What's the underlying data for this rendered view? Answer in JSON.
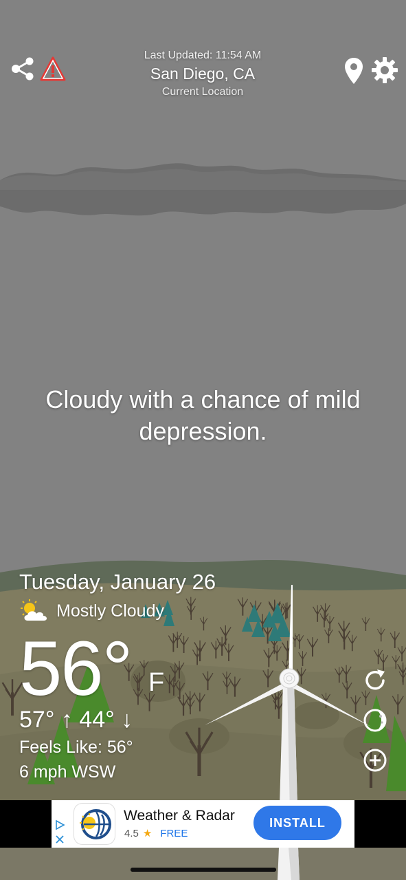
{
  "header": {
    "last_updated": "Last Updated: 11:54 AM",
    "city": "San Diego, CA",
    "location_type": "Current Location",
    "icons": [
      "share-icon",
      "alert-icon",
      "location-pin-icon",
      "gear-icon"
    ]
  },
  "quote": {
    "text": "Cloudy with a chance of mild depression."
  },
  "weather": {
    "date": "Tuesday, January 26",
    "condition_icon": "partly-cloudy-icon",
    "condition": "Mostly Cloudy",
    "temperature": "56°",
    "unit": "F",
    "hi_lo": "57° ↑  44° ↓",
    "feels_like": "Feels Like: 56°",
    "wind": "6 mph WSW"
  },
  "side_actions": {
    "icons": [
      "refresh-icon",
      "moon-phase-icon",
      "add-icon"
    ]
  },
  "ad": {
    "app_name": "Weather & Radar",
    "rating": "4.5",
    "price": "FREE",
    "cta": "INSTALL",
    "icons": [
      "ad-choices-icon",
      "app-logo-icon",
      "star-icon"
    ]
  },
  "colors": {
    "sky": "#828282",
    "ground": "#807c60",
    "tree": "#4a3f34",
    "pine": "#2e7a78",
    "grass_tree": "#4a8a2c",
    "install_button": "#2f78e8"
  }
}
